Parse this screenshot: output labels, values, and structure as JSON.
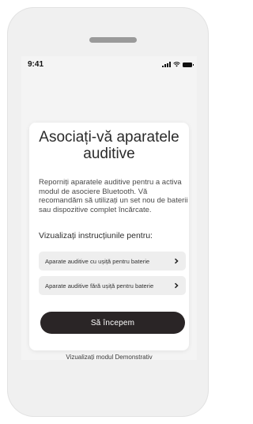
{
  "status_bar": {
    "time": "9:41"
  },
  "card": {
    "title": "Asociați-vă aparatele auditive",
    "description": "Reporniți aparatele auditive pentru a activa modul de asociere Bluetooth. Vă recomandăm să utilizați un set nou de baterii sau dispozitive complet încărcate.",
    "instructions_label": "Vizualizați instrucțiunile pentru:",
    "options": [
      {
        "label": "Aparate auditive cu ușiță pentru baterie"
      },
      {
        "label": "Aparate auditive fără ușiță pentru baterie"
      }
    ],
    "start_button": "Să începem"
  },
  "demo_link": "Vizualizați modul Demonstrativ",
  "colors": {
    "button_bg": "#2a2526",
    "option_bg": "#eeeeee",
    "screen_bg": "#f4f4f4"
  }
}
